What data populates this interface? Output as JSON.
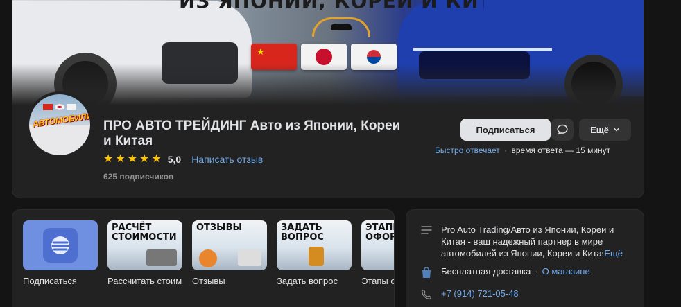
{
  "cover": {
    "headline": "ИЗ ЯПОНИИ, КОРЕИ И КИТАЯ"
  },
  "avatar": {
    "text": "АВТОМОБИЛИ"
  },
  "profile": {
    "title": "ПРО АВТО ТРЕЙДИНГ Авто из Японии, Кореи и Китая",
    "rating": "5,0",
    "stars": 5,
    "review_link": "Написать отзыв",
    "subscribers": "625 подписчиков"
  },
  "actions": {
    "subscribe": "Подписаться",
    "more": "Ещё",
    "response_fast": "Быстро отвечает",
    "response_dot": "·",
    "response_time": "время ответа — 15 минут"
  },
  "widgets": [
    {
      "caption": "Подписаться",
      "thumb_text": ""
    },
    {
      "caption": "Рассчитать стоимость",
      "thumb_text": "РАСЧЁТ СТОИМОСТИ"
    },
    {
      "caption": "Отзывы",
      "thumb_text": "ОТЗЫВЫ"
    },
    {
      "caption": "Задать вопрос",
      "thumb_text": "ЗАДАТЬ ВОПРОС"
    },
    {
      "caption": "Этапы оформления",
      "thumb_text": "ЭТАПЫ ОФОРМЛЕНИЯ"
    }
  ],
  "info": {
    "description": "Pro Auto Trading/Авто из Японии, Кореи и Китая - ваш надежный партнер в мире автомобилей из Японии, Кореи и Китая",
    "description_more": "Ещё",
    "delivery": "Бесплатная доставка",
    "shop_link": "О магазине",
    "phone": "+7 (914) 721-05-48"
  },
  "colors": {
    "accent_link": "#71aaeb",
    "star": "#ffc300",
    "card_bg": "#222222",
    "page_bg": "#141414"
  }
}
